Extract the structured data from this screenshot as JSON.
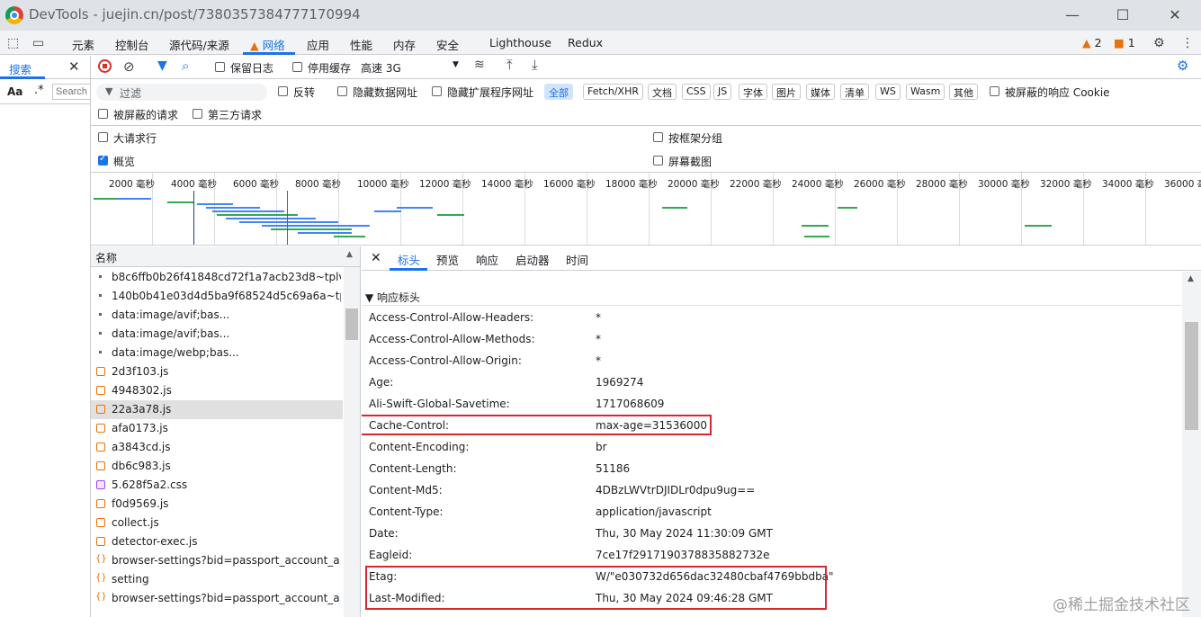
{
  "window": {
    "title": "DevTools - juejin.cn/post/7380357384777170994"
  },
  "tabs": [
    "元素",
    "控制台",
    "源代码/来源",
    "网络",
    "应用",
    "性能",
    "内存",
    "安全",
    "Lighthouse",
    "Redux"
  ],
  "active_tab": "网络",
  "badges": {
    "warnings": "2",
    "issues": "1"
  },
  "search_pane": {
    "title": "搜索",
    "aa": "Aa",
    "regex": ".*",
    "placeholder": "Search"
  },
  "toolbar": {
    "preserve_log": "保留日志",
    "disable_cache": "停用缓存",
    "throttle": "高速 3G"
  },
  "filter": {
    "placeholder": "过滤",
    "invert": "反转",
    "hide_data_urls": "隐藏数据网址",
    "hide_ext_urls": "隐藏扩展程序网址",
    "types": [
      "全部",
      "Fetch/XHR",
      "文档",
      "CSS",
      "JS",
      "字体",
      "图片",
      "媒体",
      "清单",
      "WS",
      "Wasm",
      "其他"
    ],
    "blocked_cookies": "被屏蔽的响应 Cookie",
    "blocked_requests": "被屏蔽的请求",
    "third_party": "第三方请求"
  },
  "options": {
    "big_rows": "大请求行",
    "overview": "概览",
    "group_by_frame": "按框架分组",
    "screenshots": "屏幕截图"
  },
  "timeline": {
    "ticks": [
      "2000 毫秒",
      "4000 毫秒",
      "6000 毫秒",
      "8000 毫秒",
      "10000 毫秒",
      "12000 毫秒",
      "14000 毫秒",
      "16000 毫秒",
      "18000 毫秒",
      "20000 毫秒",
      "22000 毫秒",
      "24000 毫秒",
      "26000 毫秒",
      "28000 毫秒",
      "30000 毫秒",
      "32000 毫秒",
      "34000 毫秒",
      "36000 毫秒"
    ]
  },
  "request_list": {
    "header": "名称",
    "rows": [
      {
        "name": "b8c6ffb0b26f41848cd72f1a7acb23d8~tplv...",
        "icon": "image-icon"
      },
      {
        "name": "140b0b41e03d4d5ba9f68524d5c69a6a~tpl...",
        "icon": "image-icon"
      },
      {
        "name": "data:image/avif;bas...",
        "icon": "image-icon"
      },
      {
        "name": "data:image/avif;bas...",
        "icon": "image-icon"
      },
      {
        "name": "data:image/webp;bas...",
        "icon": "image-icon"
      },
      {
        "name": "2d3f103.js",
        "icon": "script-icon"
      },
      {
        "name": "4948302.js",
        "icon": "script-icon"
      },
      {
        "name": "22a3a78.js",
        "icon": "script-icon"
      },
      {
        "name": "afa0173.js",
        "icon": "script-icon"
      },
      {
        "name": "a3843cd.js",
        "icon": "script-icon"
      },
      {
        "name": "db6c983.js",
        "icon": "script-icon"
      },
      {
        "name": "5.628f5a2.css",
        "icon": "stylesheet-icon"
      },
      {
        "name": "f0d9569.js",
        "icon": "script-icon"
      },
      {
        "name": "collect.js",
        "icon": "script-icon"
      },
      {
        "name": "detector-exec.js",
        "icon": "script-icon"
      },
      {
        "name": "browser-settings?bid=passport_account_a...",
        "icon": "fetch-icon"
      },
      {
        "name": "setting",
        "icon": "fetch-icon"
      },
      {
        "name": "browser-settings?bid=passport_account_a...",
        "icon": "fetch-icon"
      }
    ],
    "selected_index": 7
  },
  "details": {
    "tabs": [
      "标头",
      "预览",
      "响应",
      "启动器",
      "时间"
    ],
    "section": "▼ 响应标头",
    "headers": [
      {
        "name": "Access-Control-Allow-Headers:",
        "value": "*"
      },
      {
        "name": "Access-Control-Allow-Methods:",
        "value": "*"
      },
      {
        "name": "Access-Control-Allow-Origin:",
        "value": "*"
      },
      {
        "name": "Age:",
        "value": "1969274"
      },
      {
        "name": "Ali-Swift-Global-Savetime:",
        "value": "1717068609"
      },
      {
        "name": "Cache-Control:",
        "value": "max-age=31536000"
      },
      {
        "name": "Content-Encoding:",
        "value": "br"
      },
      {
        "name": "Content-Length:",
        "value": "51186"
      },
      {
        "name": "Content-Md5:",
        "value": "4DBzLWVtrDJIDLr0dpu9ug=="
      },
      {
        "name": "Content-Type:",
        "value": "application/javascript"
      },
      {
        "name": "Date:",
        "value": "Thu, 30 May 2024 11:30:09 GMT"
      },
      {
        "name": "Eagleid:",
        "value": "7ce17f2917190378835882732e"
      },
      {
        "name": "Etag:",
        "value": "W/\"e030732d656dac32480cbaf4769bbdba\""
      },
      {
        "name": "Last-Modified:",
        "value": "Thu, 30 May 2024 09:46:28 GMT"
      }
    ]
  },
  "watermark": "@稀土掘金技术社区",
  "colors": {
    "accent": "#1a73e8",
    "highlight": "#d8272e",
    "warning": "#e8710a"
  }
}
